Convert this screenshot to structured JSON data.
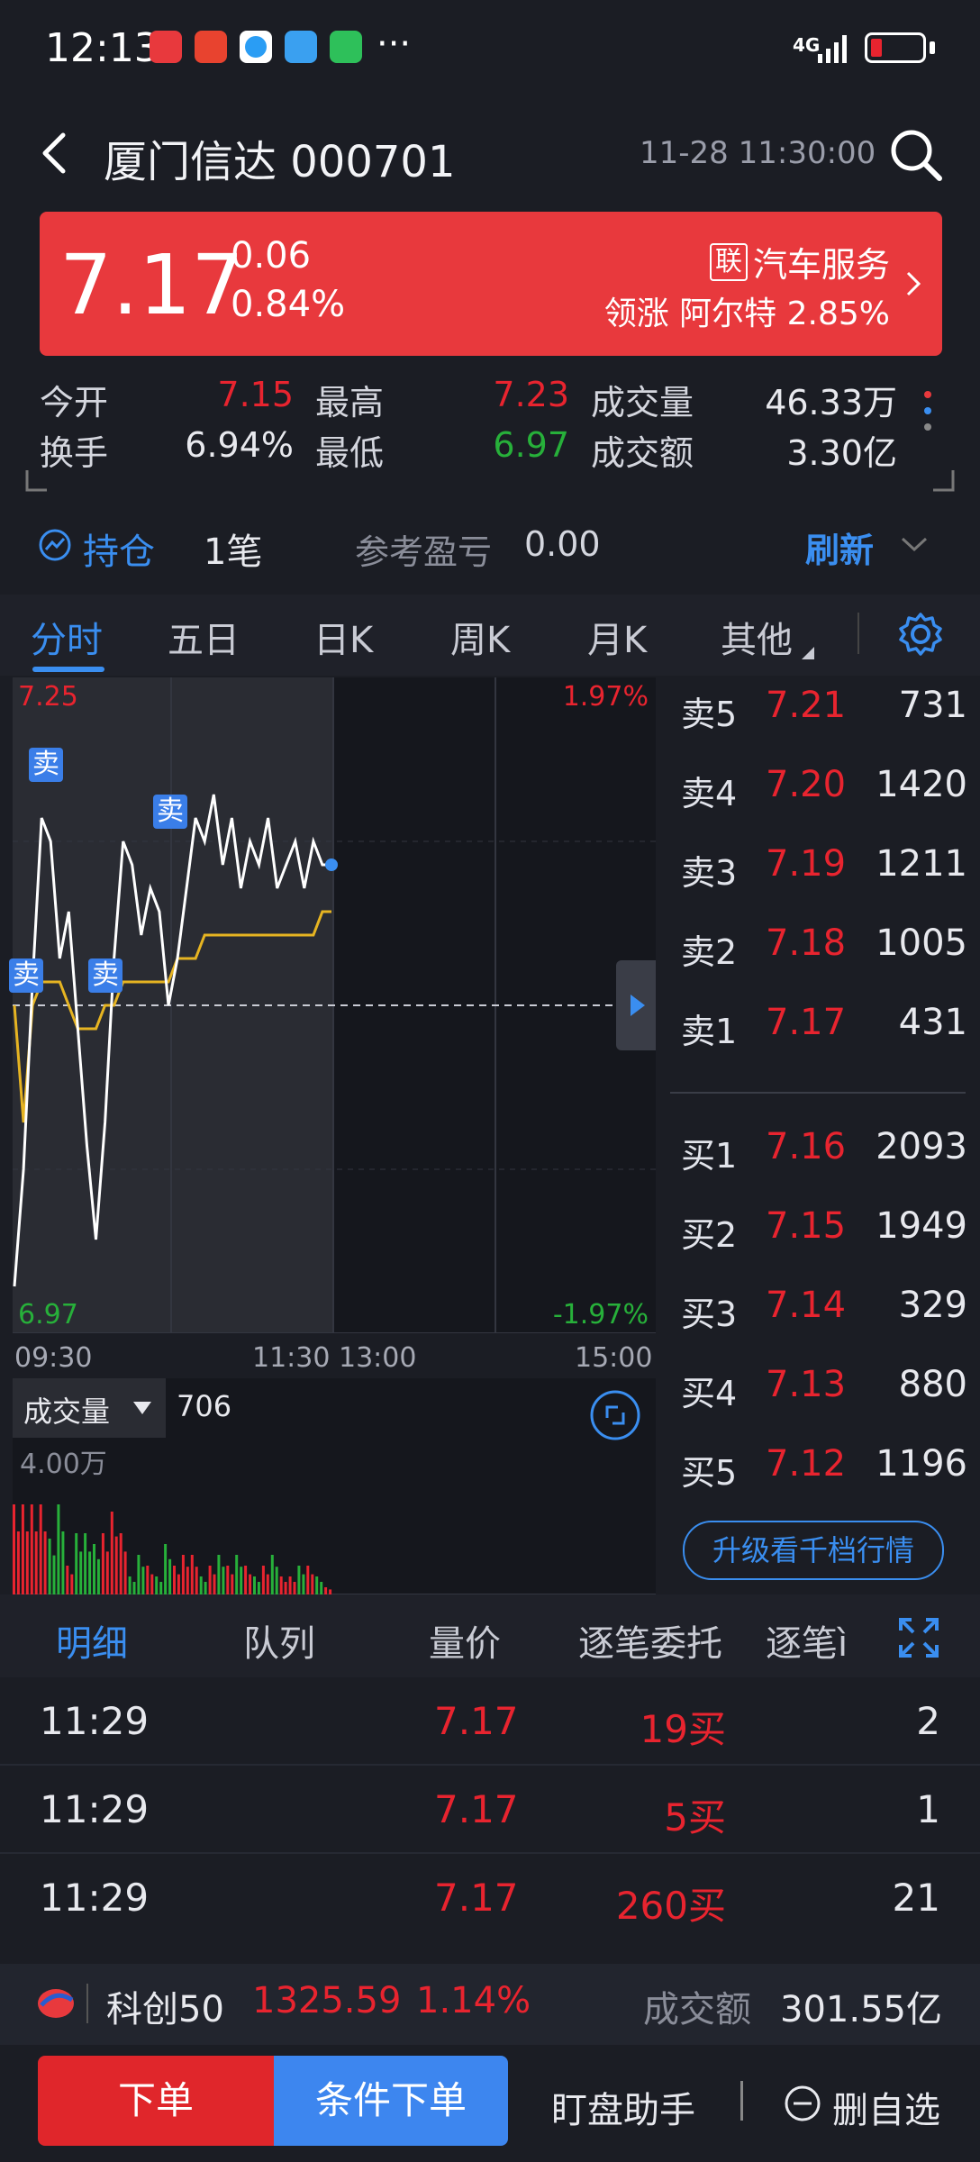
{
  "status_bar": {
    "time": "12:13",
    "app_icons": [
      "huawei-app-icon",
      "red-app-icon",
      "browser-icon",
      "gallery-icon",
      "green-app-icon"
    ],
    "more": "···",
    "network": "4G"
  },
  "header": {
    "title": "厦门信达 000701",
    "datetime": "11-28 11:30:00"
  },
  "banner": {
    "price": "7.17",
    "change": "0.06",
    "change_pct": "0.84%",
    "sector_badge": "联",
    "sector": "汽车服务",
    "leader": "领涨 阿尔特 2.85%",
    "bg_color": "#e8393d"
  },
  "stats": {
    "open_label": "今开",
    "open": "7.15",
    "high_label": "最高",
    "high": "7.23",
    "volume_label": "成交量",
    "volume": "46.33万",
    "turnover_label": "换手",
    "turnover": "6.94%",
    "low_label": "最低",
    "low": "6.97",
    "amount_label": "成交额",
    "amount": "3.30亿"
  },
  "holdings": {
    "label": "持仓",
    "count": "1笔",
    "pnl_label": "参考盈亏",
    "pnl": "0.00",
    "refresh": "刷新"
  },
  "tabs": [
    "分时",
    "五日",
    "日K",
    "周K",
    "月K",
    "其他"
  ],
  "chart": {
    "top_price": "7.25",
    "top_pct": "1.97%",
    "bottom_price": "6.97",
    "bottom_pct": "-1.97%",
    "time_labels": [
      "09:30",
      "11:30 13:00",
      "15:00"
    ],
    "sell_marker": "卖",
    "volume_label": "成交量",
    "volume_value": "706",
    "volume_scale": "4.00万"
  },
  "chart_data": {
    "type": "line",
    "title": "",
    "xlabel": "",
    "ylabel": "",
    "ylim": [
      6.97,
      7.25
    ],
    "prev_close": 7.11,
    "series": [
      {
        "values": [
          6.99,
          7.04,
          7.12,
          7.19,
          7.18,
          7.13,
          7.15,
          7.1,
          7.05,
          7.01,
          7.06,
          7.13,
          7.18,
          7.17,
          7.14,
          7.16,
          7.15,
          7.11,
          7.13,
          7.16,
          7.19,
          7.18,
          7.2,
          7.17,
          7.19,
          7.16,
          7.18,
          7.17,
          7.19,
          7.16,
          7.17,
          7.18,
          7.16,
          7.18,
          7.17,
          7.17
        ]
      },
      {
        "values": [
          7.11,
          7.06,
          7.11,
          7.12,
          7.12,
          7.12,
          7.11,
          7.1,
          7.1,
          7.1,
          7.11,
          7.11,
          7.12,
          7.12,
          7.12,
          7.12,
          7.12,
          7.12,
          7.13,
          7.13,
          7.13,
          7.14,
          7.14,
          7.14,
          7.14,
          7.14,
          7.14,
          7.14,
          7.14,
          7.14,
          7.14,
          7.14,
          7.14,
          7.14,
          7.15,
          7.15
        ]
      }
    ]
  },
  "order_book": {
    "asks": [
      {
        "label": "卖5",
        "price": "7.21",
        "vol": "731"
      },
      {
        "label": "卖4",
        "price": "7.20",
        "vol": "1420"
      },
      {
        "label": "卖3",
        "price": "7.19",
        "vol": "1211"
      },
      {
        "label": "卖2",
        "price": "7.18",
        "vol": "1005"
      },
      {
        "label": "卖1",
        "price": "7.17",
        "vol": "431"
      }
    ],
    "bids": [
      {
        "label": "买1",
        "price": "7.16",
        "vol": "2093"
      },
      {
        "label": "买2",
        "price": "7.15",
        "vol": "1949"
      },
      {
        "label": "买3",
        "price": "7.14",
        "vol": "329"
      },
      {
        "label": "买4",
        "price": "7.13",
        "vol": "880"
      },
      {
        "label": "买5",
        "price": "7.12",
        "vol": "1196"
      }
    ],
    "upgrade": "升级看千档行情"
  },
  "detail_tabs": [
    "明细",
    "队列",
    "量价",
    "逐笔委托",
    "逐笔ì"
  ],
  "trades": [
    {
      "time": "11:29",
      "price": "7.17",
      "qty": "19买",
      "count": "2"
    },
    {
      "time": "11:29",
      "price": "7.17",
      "qty": "5买",
      "count": "1"
    },
    {
      "time": "11:29",
      "price": "7.17",
      "qty": "260买",
      "count": "21"
    }
  ],
  "index_bar": {
    "name": "科创50",
    "value": "1325.59",
    "pct": "1.14%",
    "amount_label": "成交额",
    "amount": "301.55亿"
  },
  "actions": {
    "order": "下单",
    "condition_order": "条件下单",
    "assistant": "盯盘助手",
    "remove": "删自选"
  }
}
